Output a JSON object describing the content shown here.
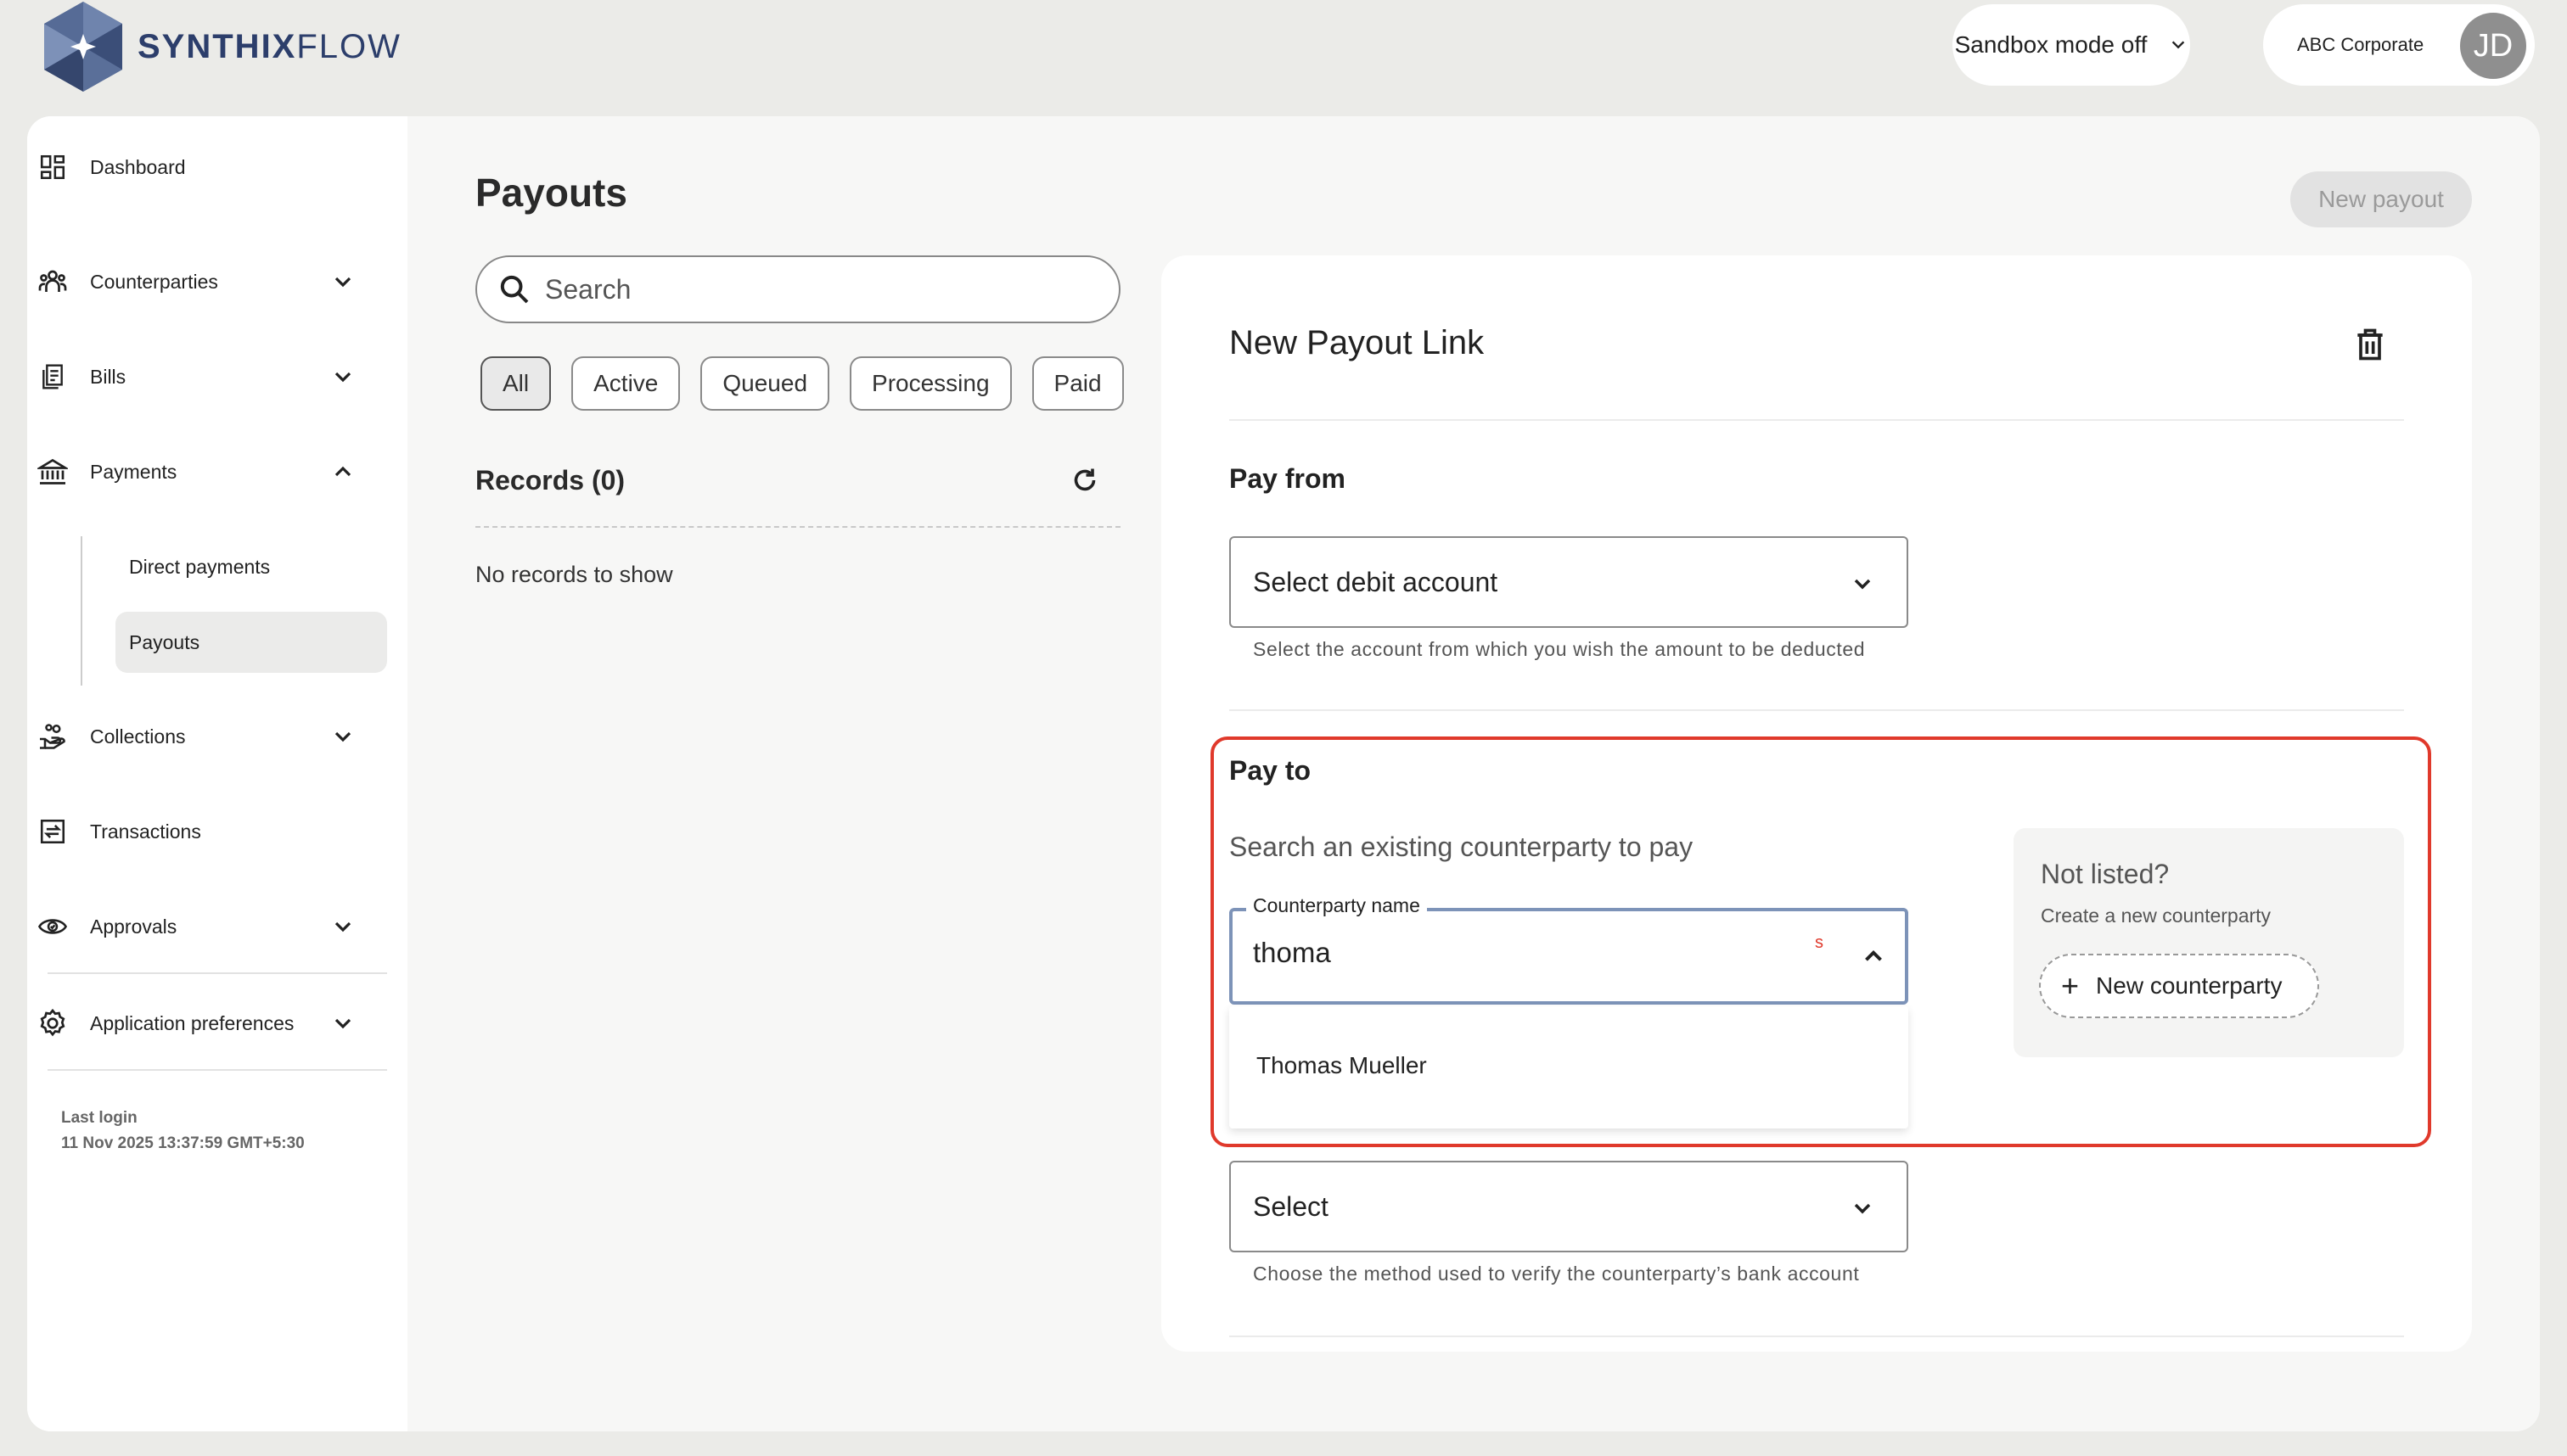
{
  "brand": {
    "name_bold": "SYNTHIX",
    "name_light": "FLOW"
  },
  "topbar": {
    "sandbox_label": "Sandbox mode off",
    "company": "ABC Corporate",
    "avatar_initials": "JD"
  },
  "sidebar": {
    "items": [
      {
        "label": "Dashboard",
        "icon": "dashboard-icon",
        "has_chevron": false
      },
      {
        "label": "Counterparties",
        "icon": "people-icon",
        "has_chevron": true
      },
      {
        "label": "Bills",
        "icon": "bills-icon",
        "has_chevron": true
      },
      {
        "label": "Payments",
        "icon": "bank-icon",
        "has_chevron": true,
        "expanded": true
      },
      {
        "label": "Collections",
        "icon": "hand-coins-icon",
        "has_chevron": true
      },
      {
        "label": "Transactions",
        "icon": "transfer-icon",
        "has_chevron": false
      },
      {
        "label": "Approvals",
        "icon": "eye-icon",
        "has_chevron": true
      },
      {
        "label": "Application preferences",
        "icon": "settings-icon",
        "has_chevron": true
      }
    ],
    "payments_sub": [
      {
        "label": "Direct payments",
        "active": false
      },
      {
        "label": "Payouts",
        "active": true
      }
    ],
    "last_login_label": "Last login",
    "last_login_value": "11 Nov 2025 13:37:59 GMT+5:30"
  },
  "payouts": {
    "title": "Payouts",
    "search_placeholder": "Search",
    "filters": [
      "All",
      "Active",
      "Queued",
      "Processing",
      "Paid"
    ],
    "active_filter": "All",
    "records_label": "Records (0)",
    "empty_text": "No records to show",
    "new_payout_label": "New payout"
  },
  "form": {
    "title": "New Payout Link",
    "pay_from": {
      "heading": "Pay from",
      "select_value": "Select debit account",
      "helper": "Select the account from which you wish the amount to be deducted"
    },
    "pay_to": {
      "heading": "Pay to",
      "search_label": "Search an existing counterparty to pay",
      "field_label": "Counterparty name",
      "field_value": "thoma",
      "field_marker": "s",
      "options": [
        "Thomas Mueller"
      ]
    },
    "not_listed": {
      "title": "Not listed?",
      "subtitle": "Create a new counterparty",
      "button": "New counterparty"
    },
    "verification": {
      "select_value": "Select",
      "helper": "Choose the method used to verify the counterparty’s bank account"
    }
  },
  "colors": {
    "highlight": "#e0392b",
    "brand": "#2c3e6b",
    "focus_border": "#7d93b8"
  }
}
